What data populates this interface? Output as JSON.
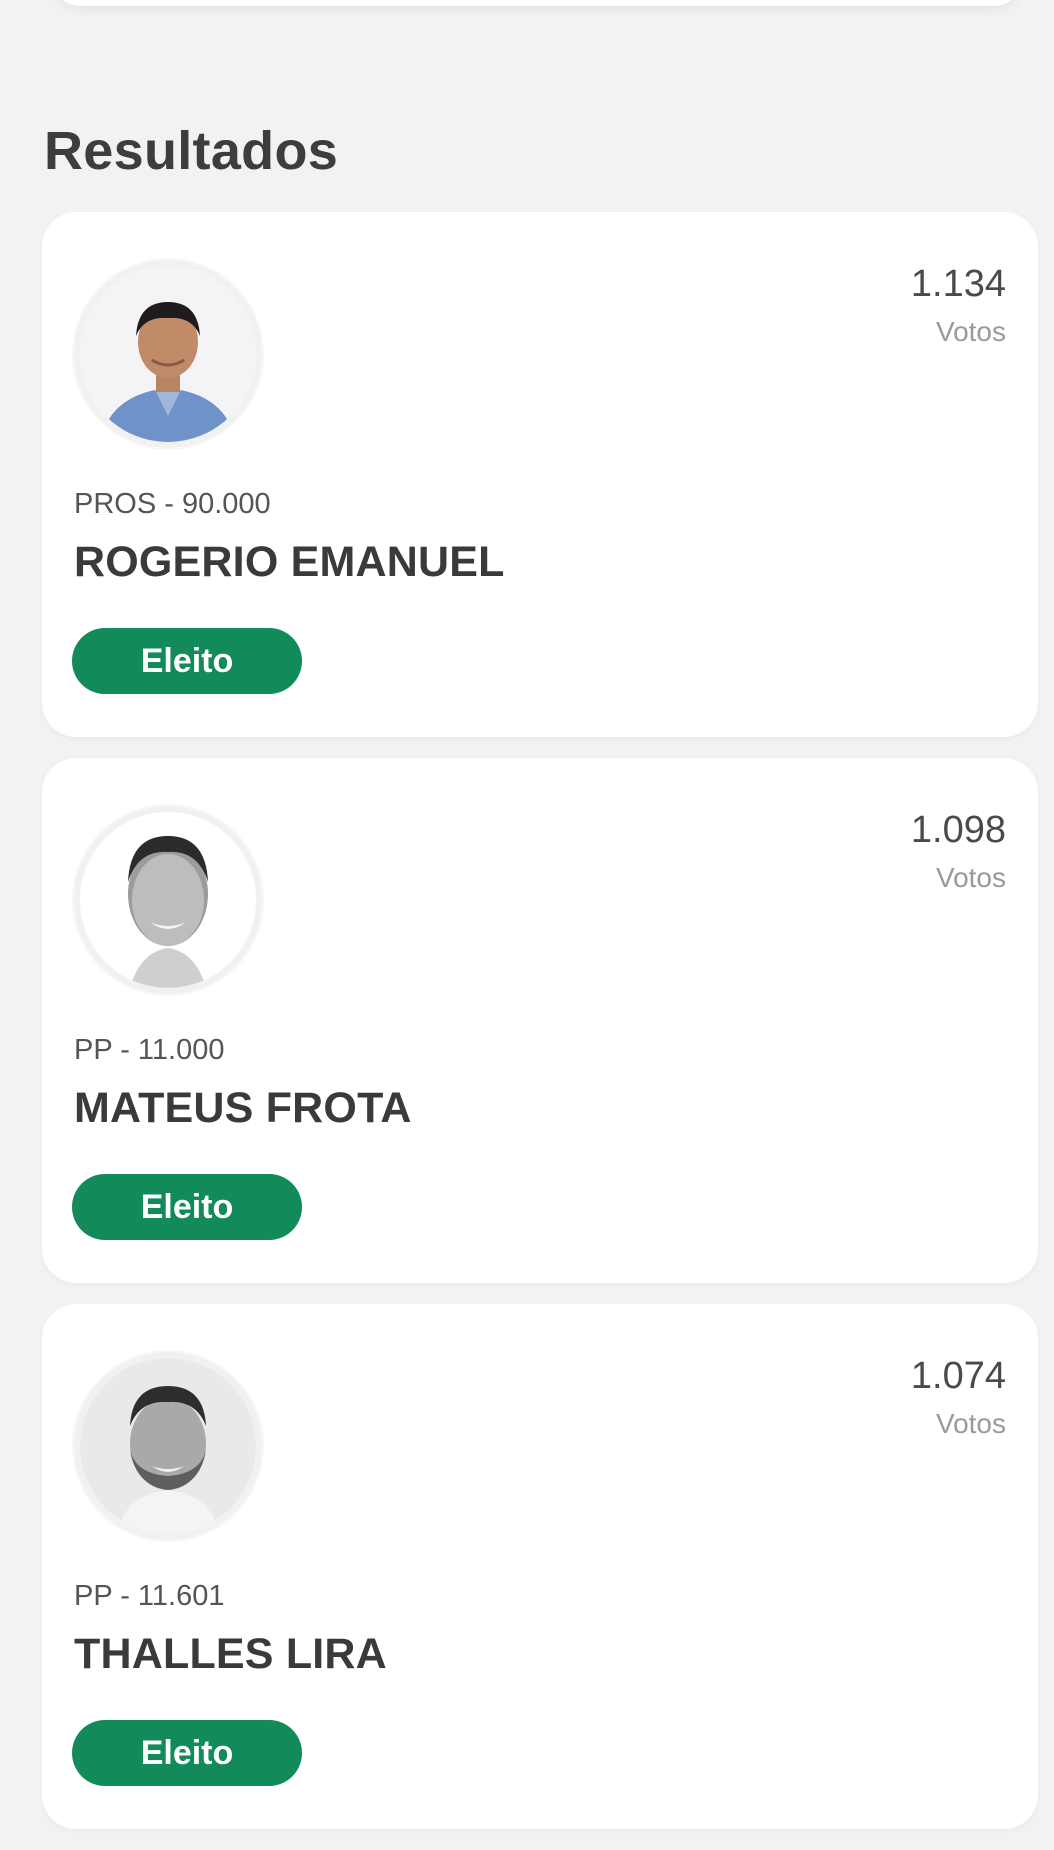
{
  "section": {
    "title": "Resultados"
  },
  "candidates": [
    {
      "party": "PROS - 90.000",
      "name": "ROGERIO EMANUEL",
      "votes": "1.134",
      "votes_label": "Votos",
      "status": "Eleito",
      "photo": "candidate-photo-color"
    },
    {
      "party": "PP - 11.000",
      "name": "MATEUS FROTA",
      "votes": "1.098",
      "votes_label": "Votos",
      "status": "Eleito",
      "photo": "candidate-photo-grayscale"
    },
    {
      "party": "PP - 11.601",
      "name": "THALLES LIRA",
      "votes": "1.074",
      "votes_label": "Votos",
      "status": "Eleito",
      "photo": "candidate-photo-grayscale"
    }
  ],
  "colors": {
    "background": "#f2f2f2",
    "card": "#ffffff",
    "badge": "#128a5a",
    "badge_text": "#ffffff"
  }
}
